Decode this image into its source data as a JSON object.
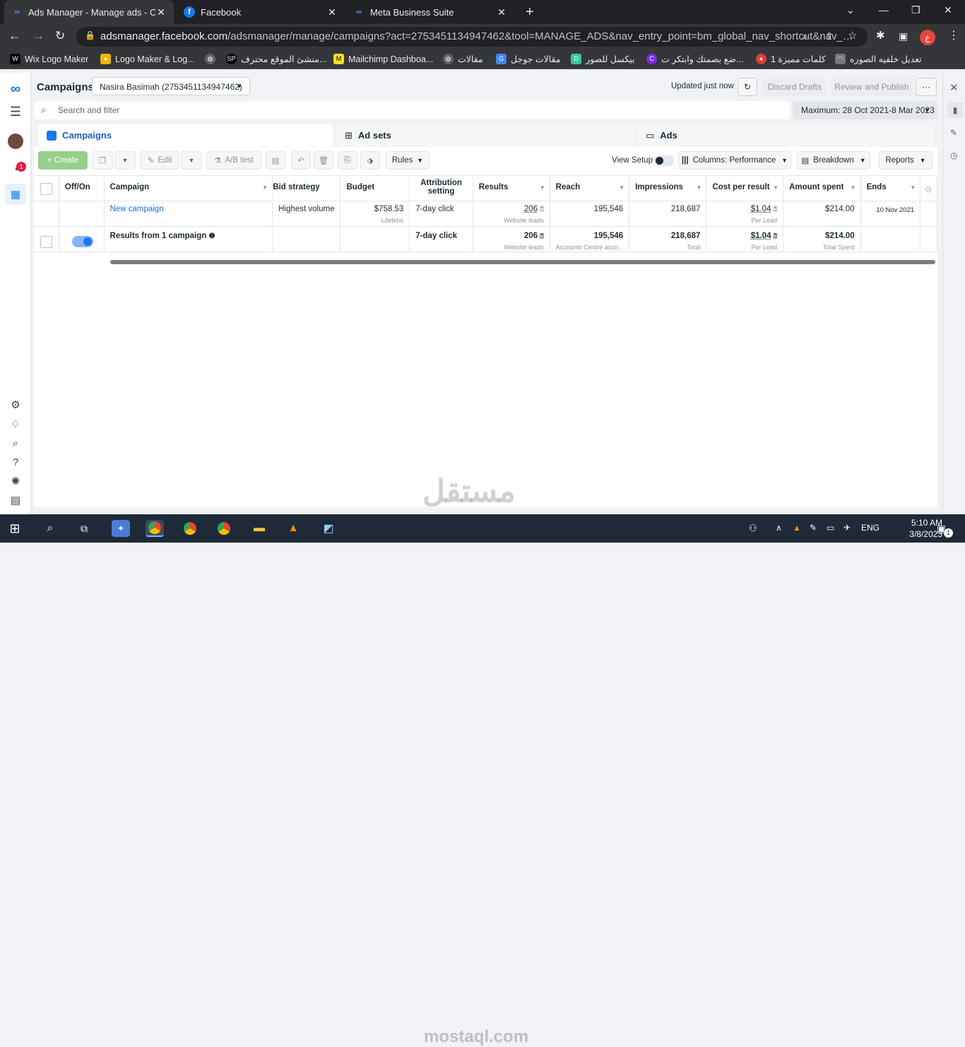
{
  "browser": {
    "tabs": [
      {
        "title": "Ads Manager - Manage ads - Campaigns",
        "active": true
      },
      {
        "title": "Facebook",
        "active": false
      },
      {
        "title": "Meta Business Suite",
        "active": false
      }
    ],
    "new_tab": "+",
    "url_host": "adsmanager.facebook.com",
    "url_path": "/adsmanager/manage/campaigns?act=2753451134947462&tool=MANAGE_ADS&nav_entry_point=bm_global_nav_shortcut&nav_…",
    "profile_initial": "ع",
    "bookmarks": [
      "Wix Logo Maker",
      "Logo Maker & Log...",
      "منشئ الموقع محترف...",
      "Mailchimp Dashboa...",
      "مقالات",
      "مقالات جوجل",
      "بيكسل للصور",
      "ضع بصمتك وابتكر ت...",
      "كلمات مميزة 1",
      "تعديل خلفيه الصوره"
    ]
  },
  "header": {
    "title": "Campaigns",
    "account": "Nasira Basimah (2753451134947462)",
    "updated": "Updated just now",
    "discard": "Discard Drafts",
    "review": "Review and Publish",
    "more": "···"
  },
  "search": {
    "placeholder": "Search and filter"
  },
  "date_range": "Maximum: 28 Oct 2021-8 Mar 2023",
  "level_tabs": {
    "campaigns": "Campaigns",
    "adsets": "Ad sets",
    "ads": "Ads"
  },
  "toolbar": {
    "create": "+ Create",
    "edit": "Edit",
    "ab_test": "A/B test",
    "rules": "Rules",
    "view_setup": "View Setup",
    "columns": "Columns: Performance",
    "breakdown": "Breakdown",
    "reports": "Reports"
  },
  "table": {
    "headers": {
      "offon": "Off/On",
      "campaign": "Campaign",
      "bid": "Bid strategy",
      "budget": "Budget",
      "attribution": "Attribution setting",
      "results": "Results",
      "reach": "Reach",
      "impressions": "Impressions",
      "cpr": "Cost per result",
      "spent": "Amount spent",
      "ends": "Ends"
    },
    "row": {
      "campaign": "New campaign",
      "bid": "Highest volume",
      "budget": "$758.53",
      "budget_sub": "Lifetime",
      "attribution": "7-day click",
      "results": "206",
      "results_sub": "Website leads",
      "reach": "195,546",
      "impressions": "218,687",
      "cpr": "$1.04",
      "cpr_sub": "Per Lead",
      "spent": "$214.00",
      "ends": "10 Nov 2021"
    },
    "summary": {
      "label": "Results from 1 campaign",
      "attribution": "7-day click",
      "results": "206",
      "results_sub": "Website leads",
      "reach": "195,546",
      "reach_sub": "Accounts Centre acco...",
      "impressions": "218,687",
      "impressions_sub": "Total",
      "cpr": "$1.04",
      "cpr_sub": "Per Lead",
      "spent": "$214.00",
      "spent_sub": "Total Spent"
    }
  },
  "taskbar": {
    "lang": "ENG",
    "time": "5:10 AM",
    "date": "3/8/2023",
    "notif": "1"
  },
  "watermark": {
    "arabic": "مستقل",
    "latin": "mostaql.com"
  },
  "colors": {
    "accent": "#1877f2",
    "create_green": "#96d08a",
    "link": "#216fdb"
  }
}
